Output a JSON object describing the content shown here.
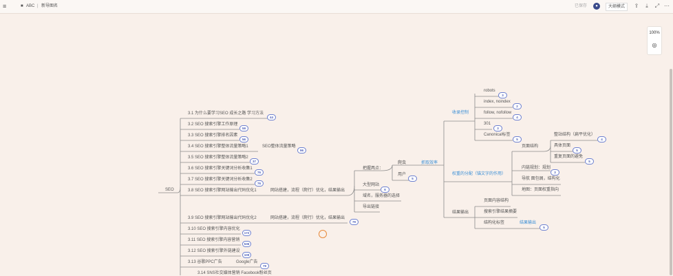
{
  "topbar": {
    "folder": "ABC",
    "doc_title": "新导图名",
    "share": "已保存",
    "ai_label": "大纲模式"
  },
  "zoom": {
    "level": "100%"
  },
  "root": "SEO",
  "left_items": [
    "3.1 为什么要学习SEO 成长之路 学习方法",
    "3.2 SEO 搜索引擎工作原理",
    "3.3 SEO 搜索引擎排名因素",
    "3.4 SEO 搜索引擎整体流量策略1",
    "3.5 SEO 搜索引擎整体流量策略2",
    "3.6 SEO 搜索引擎关键词分析收集1",
    "3.7 SEO 搜索引擎关键词分析收集2",
    "3.8 SEO 搜索引擎网站输出代码优化1",
    "3.9 SEO 搜索引擎网站输出代码优化2",
    "3.10 SEO 搜索引擎内容优化",
    "3.11 SEO 搜索引擎内容营销",
    "3.12 SEO 搜索引擎外链建设",
    "3.13 谷歌PPC广告",
    "3.14 SNS社交媒体营销 Facebook粉丝页"
  ],
  "left_badges": [
    "44",
    "59",
    "56",
    "96",
    "37",
    "76",
    "76",
    "79",
    "172",
    "536",
    "109",
    "79"
  ],
  "side_notes": {
    "strategy": "SEO整体流量策略",
    "build1": "网站搭建，流程（爬行）优化，结果输出",
    "build2": "网站搭建，流程（爬行）优化，结果输出",
    "google": "Google广告"
  },
  "mid": {
    "key_points": "把握两点：",
    "crawler": "爬虫",
    "user": "用户",
    "big_site": "大型网站",
    "domain_server": "域名，服务器的选择",
    "export_link": "导出链接",
    "crawl_eff": "抓取效率",
    "badge5": "5",
    "badge6": "6"
  },
  "right": {
    "index_control": "收录控制",
    "weight_dist": "权重的分配（锚文字的作用）",
    "result_out": "结果输出",
    "robots": "robots",
    "noindex": "index, noindex",
    "nofollow": "follow, nofollow",
    "r301": "301",
    "canonical": "Canonical标签",
    "page_struct": "页面结构",
    "inner_link": "内链规划：规划",
    "nav": "导航 面包屑，结构化",
    "sitemap": "地图：页面权重指向",
    "overall": "整站结构（扁平优化）",
    "specific": "具体页面",
    "dup": "重复页面的避免",
    "page_content": "页面内容结构",
    "serp_summary": "搜索引擎结果摘要",
    "structured": "结构化标签",
    "result_out2": "结果输出",
    "badges": [
      "3",
      "2",
      "4",
      "3",
      "5",
      "3",
      "4",
      "5",
      "5"
    ]
  }
}
